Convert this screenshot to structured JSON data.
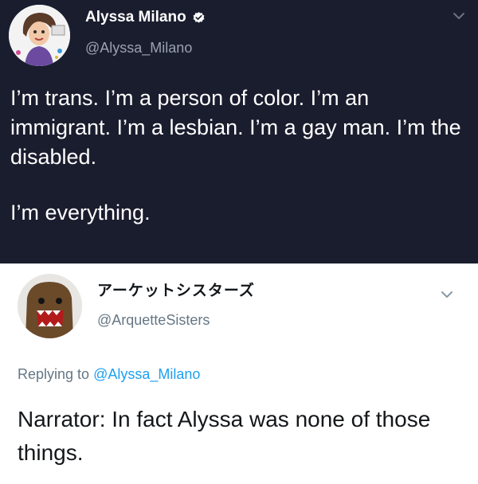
{
  "original_tweet": {
    "display_name": "Alyssa Milano",
    "handle": "@Alyssa_Milano",
    "verified": true,
    "text_lines": [
      "I’m trans. I’m a person of color. I’m an immigrant. I’m a lesbian. I’m a gay man. I’m the disabled.",
      "I’m everything."
    ],
    "avatar_icon": "cartoon-portrait-avatar",
    "background": "#1a1d2e",
    "verified_color": "#ffffff"
  },
  "reply_tweet": {
    "display_name": "アーケットシスターズ",
    "handle": "@ArquetteSisters",
    "replying_to_prefix": "Replying to",
    "replying_to_handle": "@Alyssa_Milano",
    "text": "Narrator: In fact Alyssa was none of those things.",
    "avatar_icon": "domo-avatar",
    "mention_color": "#1da1f2",
    "background": "#ffffff"
  }
}
